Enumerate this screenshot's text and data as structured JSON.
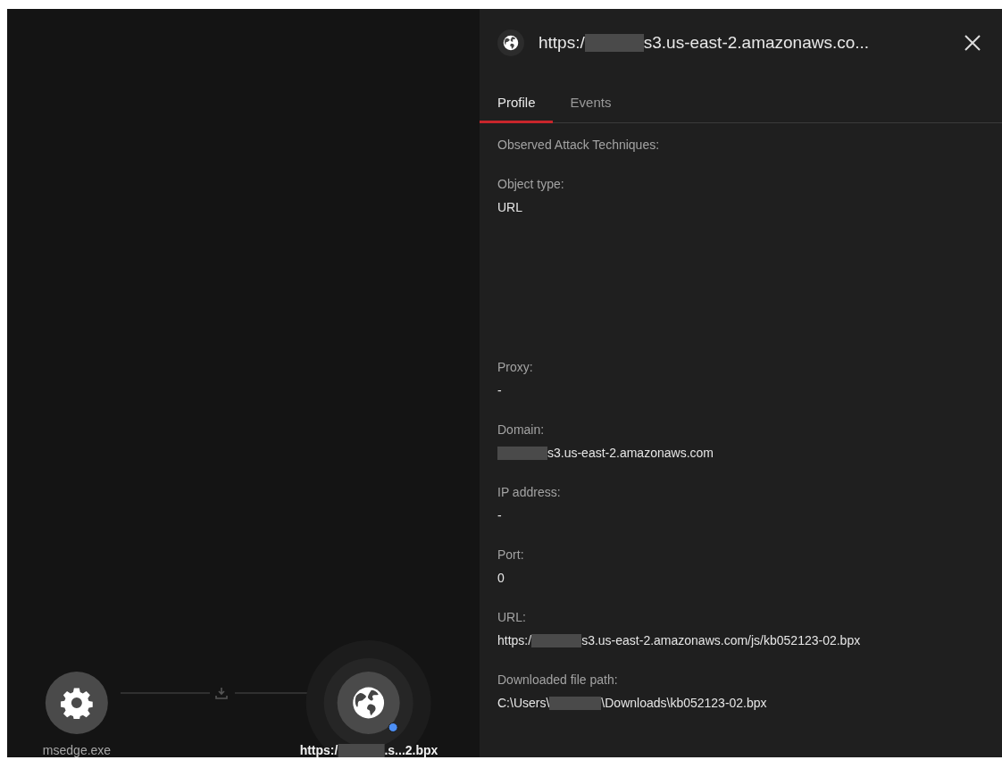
{
  "graph": {
    "nodes": [
      {
        "kind": "process",
        "label": {
          "prefix": "msedge.exe"
        },
        "badge": false
      },
      {
        "kind": "url",
        "label": {
          "prefix": "https:/",
          "redacted": true,
          "suffix": ".s...2.bpx"
        },
        "badge": true
      }
    ]
  },
  "panel": {
    "title": {
      "prefix": "https:/",
      "redacted": true,
      "suffix": "s3.us-east-2.amazonaws.co..."
    },
    "tabs": [
      {
        "label": "Profile",
        "selected": true
      },
      {
        "label": "Events",
        "selected": false
      }
    ],
    "fields": [
      {
        "label": "Observed Attack Techniques:"
      },
      {
        "label": "Object type:",
        "value": {
          "prefix": "URL"
        }
      },
      {
        "label": "Proxy:",
        "value": {
          "prefix": "-"
        }
      },
      {
        "label": "Domain:",
        "value": {
          "redacted": true,
          "suffix": "s3.us-east-2.amazonaws.com"
        }
      },
      {
        "label": "IP address:",
        "value": {
          "prefix": "-"
        }
      },
      {
        "label": "Port:",
        "value": {
          "prefix": "0"
        }
      },
      {
        "label": "URL:",
        "value": {
          "prefix": "https:/",
          "redacted": true,
          "suffix": "s3.us-east-2.amazonaws.com/js/kb052123-02.bpx"
        }
      },
      {
        "label": "Downloaded file path:",
        "value": {
          "prefix": "C:\\Users\\",
          "redacted": true,
          "suffix": "\\Downloads\\kb052123-02.bpx"
        }
      }
    ]
  }
}
